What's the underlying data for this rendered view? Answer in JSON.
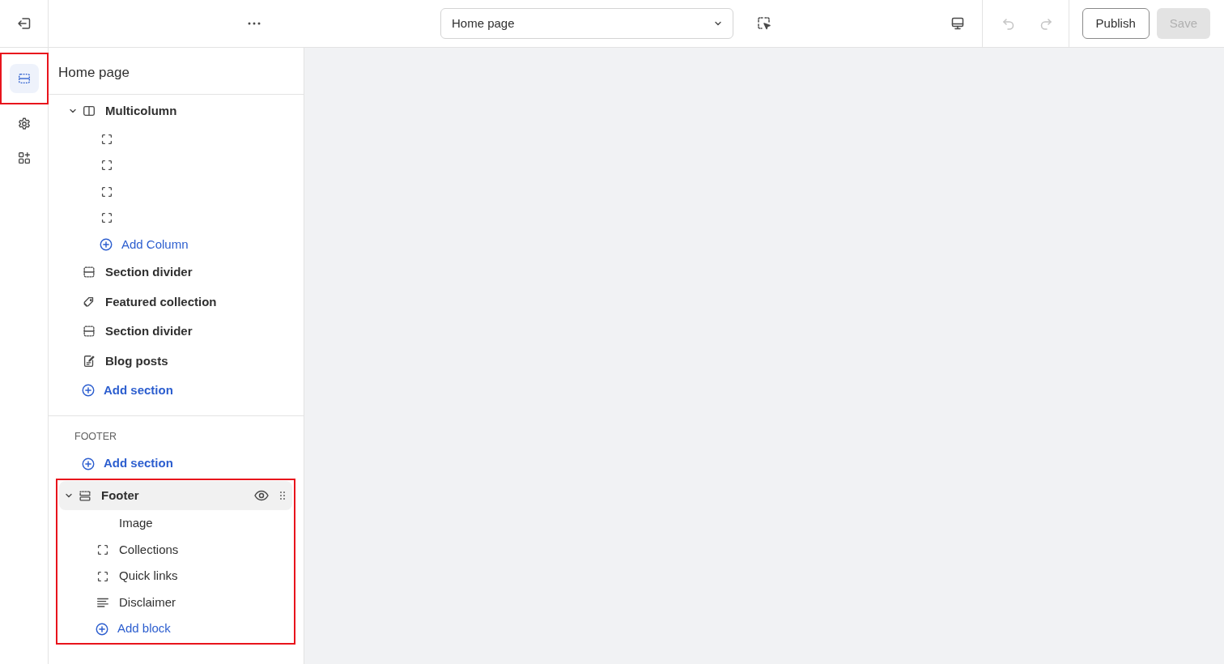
{
  "rail": {
    "items": [
      {
        "selected": true,
        "highlighted": true
      },
      {
        "selected": false,
        "highlighted": false
      },
      {
        "selected": false,
        "highlighted": false
      }
    ]
  },
  "topbar": {
    "page_select": {
      "value": "Home page"
    },
    "buttons": [
      {
        "label": "Publish",
        "disabled": false
      },
      {
        "label": "Save",
        "disabled": true
      }
    ],
    "undo_disabled": true,
    "redo_disabled": true
  },
  "panel": {
    "title": "Home page",
    "template": [
      {
        "kind": "multicolumn",
        "label": "Multicolumn",
        "expanded": true,
        "selected": false,
        "highlighted": false,
        "children": [
          {
            "kind": "block"
          },
          {
            "kind": "block"
          },
          {
            "kind": "block"
          },
          {
            "kind": "block"
          },
          {
            "kind": "add",
            "label": "Add Column"
          }
        ]
      },
      {
        "kind": "divider",
        "label": "Section divider",
        "selected": false,
        "highlighted": false
      },
      {
        "kind": "collection",
        "label": "Featured collection",
        "selected": false,
        "highlighted": false
      },
      {
        "kind": "divider",
        "label": "Section divider",
        "selected": false,
        "highlighted": false
      },
      {
        "kind": "blog",
        "label": "Blog posts",
        "selected": false,
        "highlighted": false
      },
      {
        "kind": "add",
        "label": "Add section"
      }
    ],
    "footer_group": {
      "heading": "FOOTER",
      "items": [
        {
          "kind": "add",
          "label": "Add section"
        },
        {
          "kind": "footer",
          "label": "Footer",
          "expanded": true,
          "selected": true,
          "highlighted": true,
          "children": [
            {
              "kind": "image",
              "label": "Image"
            },
            {
              "kind": "block",
              "label": "Collections"
            },
            {
              "kind": "block",
              "label": "Quick links"
            },
            {
              "kind": "text",
              "label": "Disclaimer"
            },
            {
              "kind": "add",
              "label": "Add block"
            }
          ]
        }
      ]
    }
  }
}
